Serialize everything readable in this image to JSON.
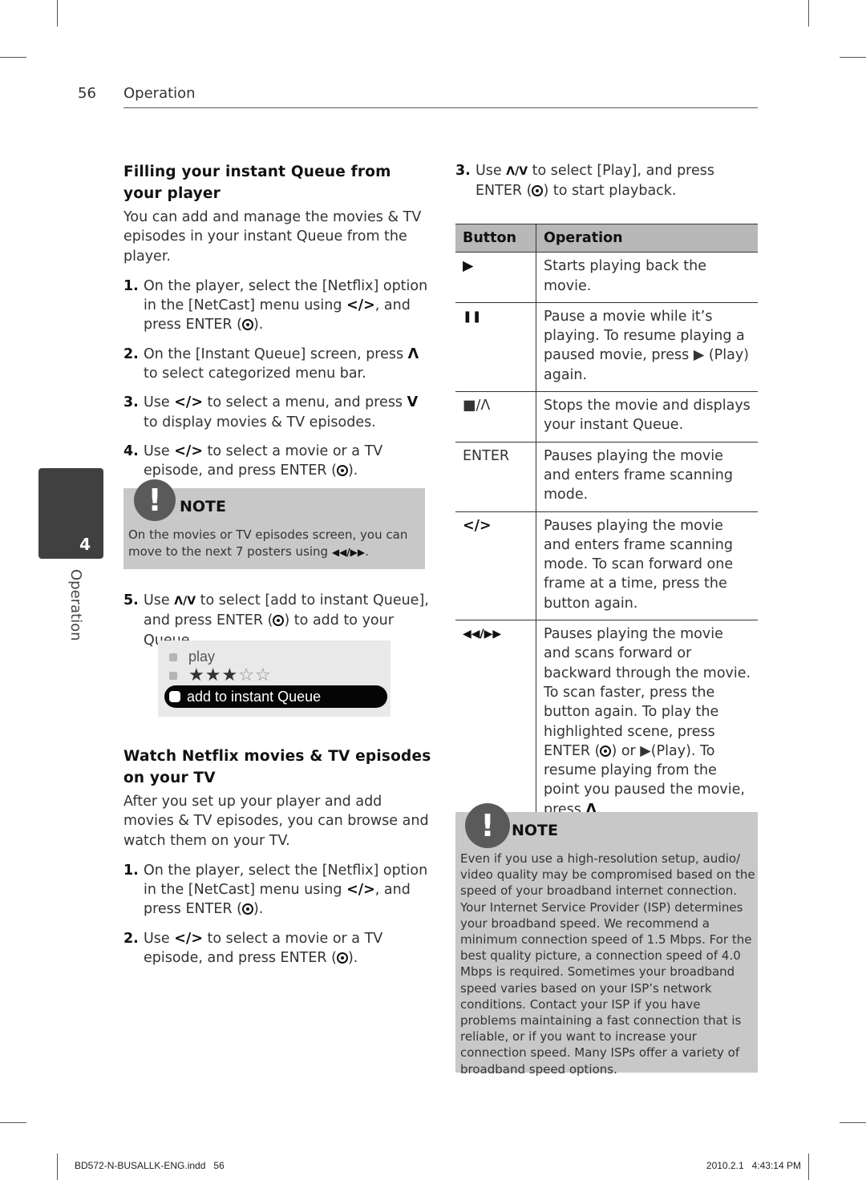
{
  "header": {
    "page_number": "56",
    "section": "Operation"
  },
  "side_tab": {
    "chapter_number": "4",
    "chapter_label": "Operation"
  },
  "section1": {
    "title": "Filling your instant Queue from your player",
    "intro": "You can add and manage the movies & TV episodes in your instant Queue from the player.",
    "steps": [
      {
        "num": "1.",
        "pre": "On the player, select the [Netflix] option in the [NetCast] menu using ",
        "key": "</>",
        "post": ", and press ENTER (",
        "icon": "enter",
        "end": ")."
      },
      {
        "num": "2.",
        "pre": "On the [Instant Queue] screen, press ",
        "key": "Λ",
        "post": " to select categorized menu bar.",
        "icon": "",
        "end": ""
      },
      {
        "num": "3.",
        "pre": "Use ",
        "key": "</>",
        "post": " to select a menu, and press ",
        "key2": "V",
        "post2": " to display movies & TV episodes."
      },
      {
        "num": "4.",
        "pre": "Use ",
        "key": "</>",
        "post": " to select a movie or a TV episode, and press ENTER (",
        "icon": "enter",
        "end": ")."
      }
    ],
    "note": {
      "title": "NOTE",
      "body_pre": "On the movies or TV episodes screen, you can move to the next 7 posters using ",
      "body_key": "◀◀/▶▶",
      "body_end": "."
    },
    "step5": {
      "num": "5.",
      "pre": "Use ",
      "key": "Λ/V",
      "post": " to select [add to instant Queue], and press ENTER (",
      "end": ") to add to your Queue."
    },
    "screenshot": {
      "play_label": "play",
      "rating_stars": 3,
      "rating_max": 5,
      "queue_label": "add to instant Queue"
    }
  },
  "section2": {
    "title": "Watch Netflix movies & TV episodes on your TV",
    "intro": "After you set up your player and add movies & TV episodes, you can browse and watch them on your TV.",
    "steps": [
      {
        "num": "1.",
        "pre": "On the player, select the [Netflix] option in the [NetCast] menu using ",
        "key": "</>",
        "post": ", and press ENTER (",
        "end": ")."
      },
      {
        "num": "2.",
        "pre": "Use ",
        "key": "</>",
        "post": " to select a movie or a TV episode, and press ENTER (",
        "end": ")."
      }
    ],
    "step3": {
      "num": "3.",
      "pre": "Use ",
      "key": "Λ/V",
      "post": " to select [Play], and press ENTER (",
      "end": ") to start playback."
    }
  },
  "table": {
    "headers": [
      "Button",
      "Operation"
    ],
    "rows": [
      {
        "button": "▶",
        "operation": "Starts playing back the movie."
      },
      {
        "button": "❚❚",
        "operation": "Pause a movie while it’s playing. To resume playing a paused movie, press ▶ (Play) again."
      },
      {
        "button": "■/Λ",
        "operation": "Stops the movie and displays your instant Queue."
      },
      {
        "button": "ENTER",
        "operation": "Pauses playing the movie and enters frame scanning mode."
      },
      {
        "button": "</>",
        "operation": "Pauses playing the movie and enters frame scanning mode. To scan forward one frame at a time, press the button again."
      },
      {
        "button": "◀◀/▶▶",
        "operation_pre": "Pauses playing the movie and scans forward or backward through the movie. To scan faster, press the button again. To play the highlighted scene, press ENTER (",
        "operation_mid": ") or ▶(Play). To resume playing from the point you paused the movie, press ",
        "operation_key": "Λ",
        "operation_end": "."
      }
    ]
  },
  "note2": {
    "title": "NOTE",
    "body": "Even if you use a high-resolution setup, audio/ video quality may be compromised based on the speed of your broadband internet connection. Your Internet Service Provider (ISP) determines your broadband speed. We recommend a minimum connection speed of 1.5 Mbps. For the best quality picture, a connection speed of 4.0 Mbps is required. Sometimes your broadband speed varies based on your ISP’s network conditions. Contact your ISP if you have problems maintaining a fast connection that is reliable, or if you want to increase your connection speed. Many ISPs offer a variety of broadband speed options."
  },
  "footer": {
    "file": "BD572-N-BUSALLK-ENG.indd   56",
    "timestamp": "2010.2.1   4:43:14 PM"
  }
}
